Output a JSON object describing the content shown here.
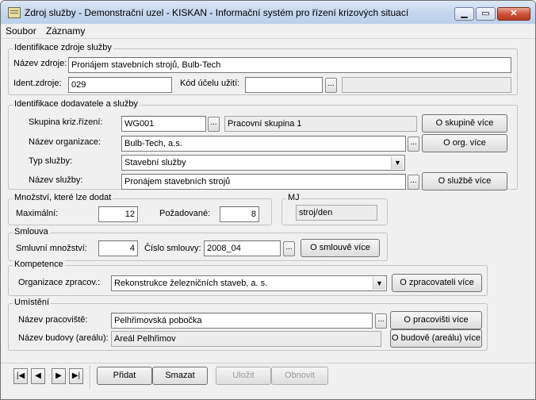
{
  "window": {
    "title": "Zdroj služby - Demonstrační uzel - KISKAN - Informační systém pro řízení krizových situací",
    "min_glyph": "▁",
    "max_glyph": "▭",
    "close_glyph": "✕"
  },
  "menu": [
    "Soubor",
    "Záznamy"
  ],
  "identifikace_zdroje": {
    "title": "Identifikace zdroje služby",
    "nazev_label": "Název zdroje:",
    "nazev_value": "Pronájem stavebních strojů, Bulb-Tech",
    "ident_label": "Ident.zdroje:",
    "ident_value": "029",
    "kod_label": "Kód účelu užití:",
    "kod_value": "",
    "kod_desc": ""
  },
  "dodavatel": {
    "title": "Identifikace dodavatele a služby",
    "skupina_label": "Skupina kriz.řízení:",
    "skupina_value": "WG001",
    "skupina_desc": "Pracovní skupina 1",
    "skupina_btn": "O skupině více",
    "org_label": "Název organizace:",
    "org_value": "Bulb-Tech, a.s.",
    "org_btn": "O org. více",
    "typ_label": "Typ služby:",
    "typ_value": "Stavební služby",
    "sluzba_label": "Název služby:",
    "sluzba_value": "Pronájem stavebních strojů",
    "sluzba_btn": "O službě více"
  },
  "mnozstvi": {
    "title": "Množství, které lze dodat",
    "max_label": "Maximální:",
    "max_value": "12",
    "pozad_label": "Požadované:",
    "pozad_value": "8"
  },
  "mj": {
    "title": "MJ",
    "value": "stroj/den"
  },
  "smlouva": {
    "title": "Smlouva",
    "mnozstvi_label": "Smluvní množství:",
    "mnozstvi_value": "4",
    "cislo_label": "Číslo smlouvy:",
    "cislo_value": "2008_04",
    "btn": "O smlouvě více"
  },
  "kompetence": {
    "title": "Kompetence",
    "org_label": "Organizace zpracov.:",
    "org_value": "Rekonstrukce železničních staveb, a. s.",
    "btn": "O zpracovateli více"
  },
  "umisteni": {
    "title": "Umístění",
    "prac_label": "Název pracoviště:",
    "prac_value": "Pelhřimovská pobočka",
    "prac_btn": "O pracovišti více",
    "budova_label": "Název budovy (areálu):",
    "budova_value": "Areál Pelhřimov",
    "budova_btn": "O budově (areálu) více"
  },
  "common": {
    "dots": "...",
    "arrow": "▼"
  },
  "navigation": {
    "first": "|◀",
    "prev": "◀",
    "next": "▶",
    "last": "▶|"
  },
  "actions": {
    "add": "Přidat",
    "delete": "Smazat",
    "save": "Uložit",
    "revert": "Obnovit"
  }
}
